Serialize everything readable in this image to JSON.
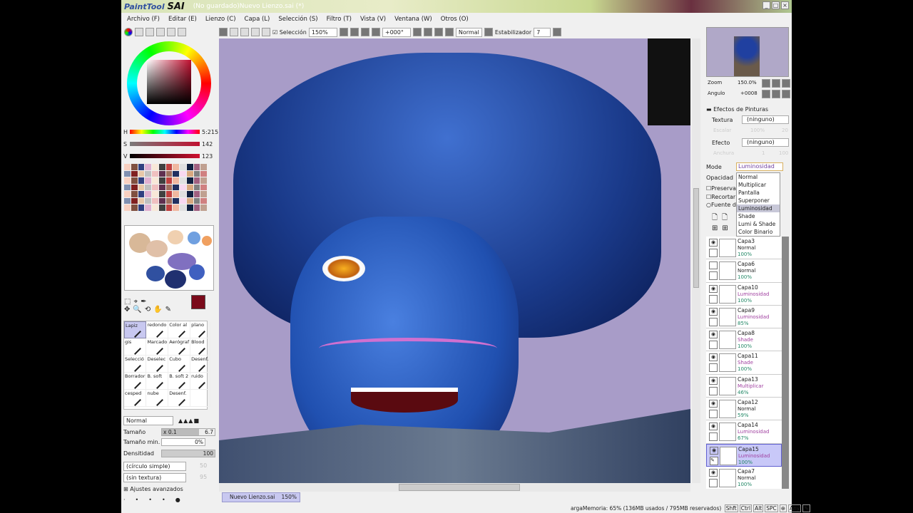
{
  "app": {
    "logo": "PaintTool SAI",
    "title": "(No guardado)Nuevo Lienzo.sai (*)"
  },
  "menu": [
    "Archivo (F)",
    "Editar (E)",
    "Lienzo (C)",
    "Capa (L)",
    "Selección (S)",
    "Filtro (T)",
    "Vista (V)",
    "Ventana (W)",
    "Otros (O)"
  ],
  "toolbar": {
    "selection_label": "Selección",
    "selection_checked": true,
    "zoom": "150%",
    "angle": "+000°",
    "blend": "Normal",
    "stabilizer_label": "Estabilizador",
    "stabilizer": "7"
  },
  "color": {
    "h_label": "H",
    "h": "5:215",
    "s_label": "S",
    "s": "142",
    "v_label": "V",
    "v": "123",
    "current": "#7a0a1a"
  },
  "brushes": [
    {
      "name": "Lapiz",
      "selected": true
    },
    {
      "name": "redondo"
    },
    {
      "name": "Color al"
    },
    {
      "name": "plano"
    },
    {
      "name": "gis"
    },
    {
      "name": "Marcado"
    },
    {
      "name": "Aerógraf"
    },
    {
      "name": "Blood"
    },
    {
      "name": "Selecció"
    },
    {
      "name": "Deselec"
    },
    {
      "name": "Cubo"
    },
    {
      "name": "Desenf."
    },
    {
      "name": "Borrador"
    },
    {
      "name": "B. soft"
    },
    {
      "name": "B. soft 2"
    },
    {
      "name": "ruido"
    },
    {
      "name": "cesped"
    },
    {
      "name": "nube"
    },
    {
      "name": "Desenf."
    },
    {
      "name": ""
    }
  ],
  "brush_settings": {
    "mode": "Normal",
    "size_label": "Tamaño",
    "size_mult": "x 0.1",
    "size": "6.7",
    "min_size_label": "Tamaño min.",
    "min_size": "0%",
    "density_label": "Densitidad",
    "density": "100",
    "shape": "(círculo simple)",
    "shape_val": "50",
    "texture": "(sin textura)",
    "texture_val": "95",
    "advanced": "Ajustes avanzados"
  },
  "navigator": {
    "zoom_label": "Zoom",
    "zoom": "150.0%",
    "angle_label": "Angulo",
    "angle": "+0008"
  },
  "effects": {
    "header": "Efectos de Pinturas",
    "texture_label": "Textura",
    "texture": "(ninguno)",
    "texture_scale_label": "Escalar",
    "texture_scale": "100%",
    "texture_strength": "20",
    "effect_label": "Efecto",
    "effect": "(ninguno)",
    "effect_width_label": "Anchura",
    "effect_width": "1",
    "effect_strength": "100"
  },
  "layer_props": {
    "mode_label": "Mode",
    "mode": "Luminosidad",
    "opacity_label": "Opacidad",
    "preserve": "Preserva",
    "clip": "Recortar",
    "source": "Fuente d"
  },
  "mode_options": [
    "Normal",
    "Multiplicar",
    "Pantalla",
    "Superponer",
    "Luminosidad",
    "Shade",
    "Lumi & Shade",
    "Color Binario"
  ],
  "mode_highlighted": "Luminosidad",
  "layers": [
    {
      "name": "Capa3",
      "mode": "Normal",
      "opacity": "100%",
      "visible": true
    },
    {
      "name": "Capa6",
      "mode": "Normal",
      "opacity": "100%",
      "visible": false
    },
    {
      "name": "Capa10",
      "mode": "Luminosidad",
      "opacity": "100%",
      "visible": true
    },
    {
      "name": "Capa9",
      "mode": "Luminosidad",
      "opacity": "85%",
      "visible": true
    },
    {
      "name": "Capa8",
      "mode": "Shade",
      "opacity": "100%",
      "visible": true
    },
    {
      "name": "Capa11",
      "mode": "Shade",
      "opacity": "100%",
      "visible": true
    },
    {
      "name": "Capa13",
      "mode": "Multiplicar",
      "opacity": "46%",
      "visible": true
    },
    {
      "name": "Capa12",
      "mode": "Normal",
      "opacity": "59%",
      "visible": true
    },
    {
      "name": "Capa14",
      "mode": "Luminosidad",
      "opacity": "67%",
      "visible": true
    },
    {
      "name": "Capa15",
      "mode": "Luminosidad",
      "opacity": "100%",
      "visible": true,
      "selected": true
    },
    {
      "name": "Capa7",
      "mode": "Normal",
      "opacity": "100%",
      "visible": true
    }
  ],
  "doc_tab": {
    "name": "Nuevo Lienzo.sai",
    "zoom": "150%"
  },
  "status": {
    "memory": "argaMemoria: 65% (136MB usados / 795MB reservados)",
    "keys": [
      "Shft",
      "Ctrl",
      "Alt",
      "SPC",
      "⊕",
      "Any",
      "✎"
    ]
  }
}
